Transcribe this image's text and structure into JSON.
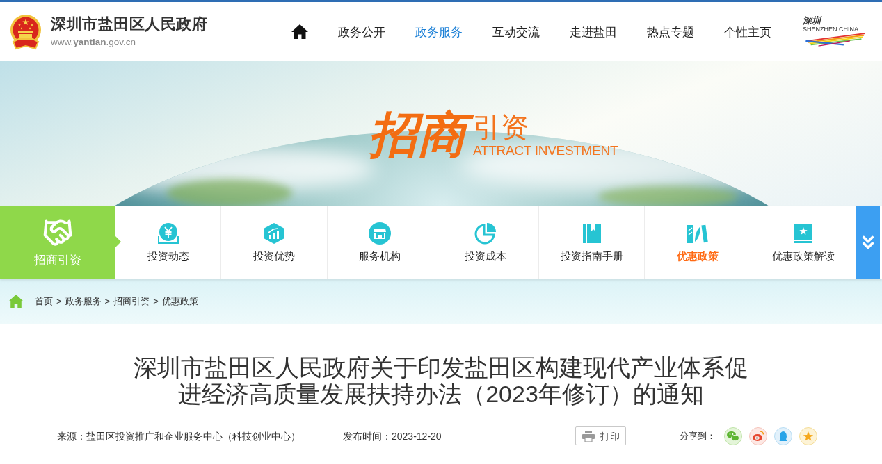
{
  "header": {
    "site_title": "深圳市盐田区人民政府",
    "site_url": "www.**yantian**.gov.cn",
    "nav": [
      {
        "label": "政务公开",
        "selected": false
      },
      {
        "label": "政务服务",
        "selected": true
      },
      {
        "label": "互动交流",
        "selected": false
      },
      {
        "label": "走进盐田",
        "selected": false
      },
      {
        "label": "热点专题",
        "selected": false
      },
      {
        "label": "个性主页",
        "selected": false
      }
    ],
    "logo_texts": [
      "深圳",
      "SHENZHEN CHINA"
    ]
  },
  "banner": {
    "title_large": "招商",
    "title_small": "引资",
    "subtitle": "ATTRACT INVESTMENT"
  },
  "section_nav": {
    "title": "招商引资",
    "items": [
      {
        "label": "投资动态",
        "selected": false
      },
      {
        "label": "投资优势",
        "selected": false
      },
      {
        "label": "服务机构",
        "selected": false
      },
      {
        "label": "投资成本",
        "selected": false
      },
      {
        "label": "投资指南手册",
        "selected": false
      },
      {
        "label": "优惠政策",
        "selected": true
      },
      {
        "label": "优惠政策解读",
        "selected": false
      }
    ]
  },
  "breadcrumb": {
    "separator": ">",
    "items": [
      "首页",
      "政务服务",
      "招商引资",
      "优惠政策"
    ]
  },
  "article": {
    "title": "深圳市盐田区人民政府关于印发盐田区构建现代产业体系促进经济高质量发展扶持办法（2023年修订）的通知",
    "source": "来源：盐田区投资推广和企业服务中心（科技创业中心）",
    "published": "发布时间：2023-12-20",
    "print_button": "打印",
    "share_label": "分享到："
  }
}
